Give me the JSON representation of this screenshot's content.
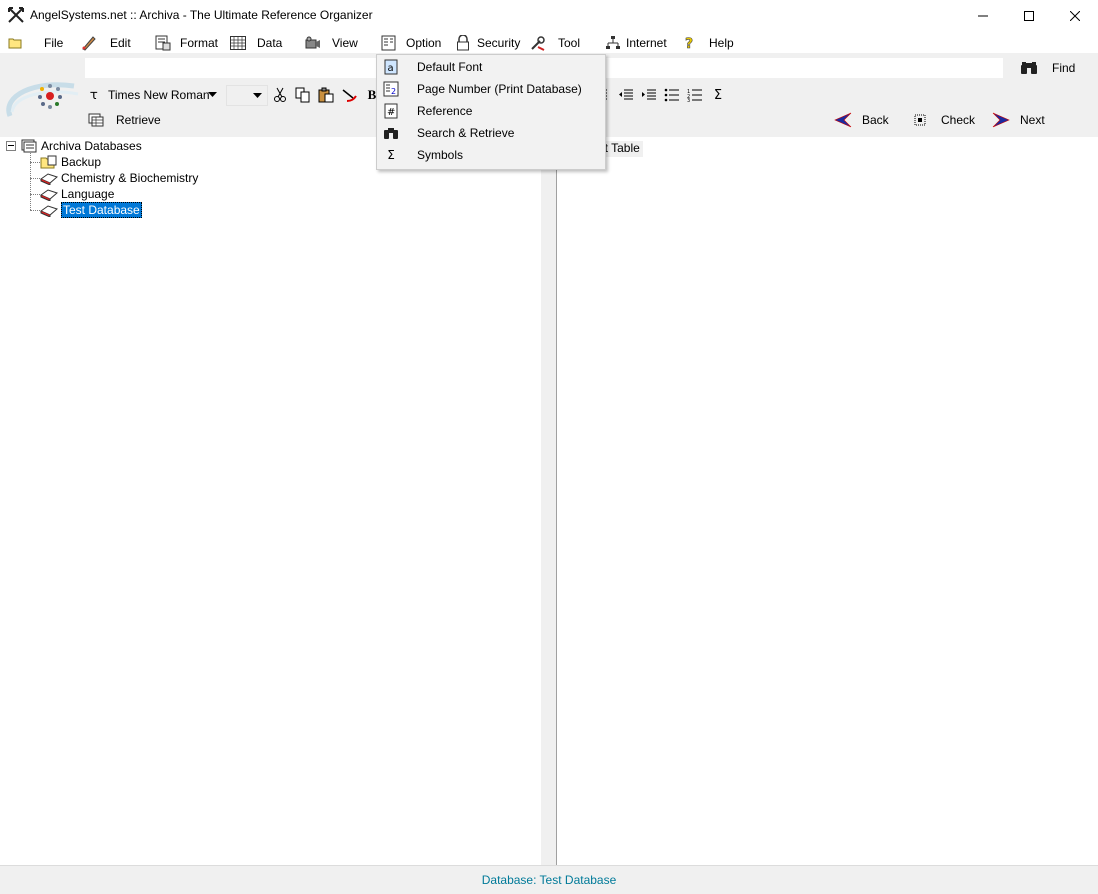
{
  "window": {
    "title": "AngelSystems.net :: Archiva - The Ultimate Reference Organizer"
  },
  "menu": {
    "file": "File",
    "edit": "Edit",
    "format": "Format",
    "data": "Data",
    "view": "View",
    "option": "Option",
    "security": "Security",
    "tool": "Tool",
    "internet": "Internet",
    "help": "Help"
  },
  "toolbar": {
    "find_label": "Find",
    "font_name": "Times New Roman",
    "font_size": "",
    "retrieve_label": "Retrieve",
    "back_label": "Back",
    "check_label": "Check",
    "next_label": "Next"
  },
  "option_menu": {
    "items": [
      "Default Font",
      "Page Number (Print Database)",
      "Reference",
      "Search & Retrieve",
      "Symbols"
    ]
  },
  "tree": {
    "root": "Archiva Databases",
    "children": [
      "Backup",
      "Chemistry & Biochemistry",
      "Language",
      "Test Database"
    ],
    "selected": "Test Database"
  },
  "right_pane": {
    "tab_label": "est Table"
  },
  "status": {
    "text": "Database: Test Database"
  },
  "colors": {
    "accent": "#0078d7",
    "status_text": "#007a99",
    "toolbar_bg": "#f0f0f0"
  }
}
